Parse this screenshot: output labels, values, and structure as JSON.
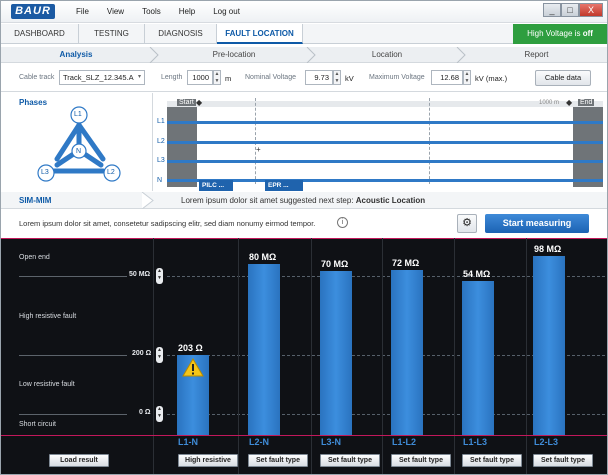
{
  "app": {
    "logo": "BAUR"
  },
  "menu": [
    "File",
    "View",
    "Tools",
    "Help",
    "Log out"
  ],
  "window_controls": {
    "minimize": "_",
    "maximize": "□",
    "close": "X"
  },
  "tabs": [
    "DASHBOARD",
    "TESTING",
    "DIAGNOSIS",
    "FAULT LOCATION"
  ],
  "active_tab": "FAULT LOCATION",
  "high_voltage": {
    "prefix": "High Voltage is",
    "state": "off",
    "color": "#2e9e3f"
  },
  "steps": [
    "Analysis",
    "Pre-location",
    "Location",
    "Report"
  ],
  "params": {
    "cable_track_label": "Cable track",
    "cable_track_value": "Track_SLZ_12.345.A",
    "length_label": "Length",
    "length_value": "1000",
    "length_unit": "m",
    "nominal_voltage_label": "Nominal Voltage",
    "nominal_voltage_value": "9.73",
    "nominal_voltage_unit": "kV",
    "max_voltage_label": "Maximum Voltage",
    "max_voltage_value": "12.68",
    "max_voltage_unit": "kV (max.)",
    "cable_data_button": "Cable data"
  },
  "phases": {
    "title": "Phases",
    "nodes": [
      "L1",
      "L2",
      "L3",
      "N"
    ]
  },
  "cable": {
    "start_label": "Start",
    "end_label": "End",
    "distance_label": "1000 m",
    "lines": [
      "L1",
      "L2",
      "L3",
      "N"
    ],
    "segments": [
      "PILC ...",
      "EPR ..."
    ]
  },
  "sim": {
    "method": "SIM-MIM",
    "suggestion_prefix": "Lorem ipsum dolor sit amet suggested next step:",
    "suggestion_step": "Acoustic Location",
    "description": "Lorem ipsum dolor sit amet, consetetur sadipscing elitr, sed diam nonumy eirmod tempor.",
    "info_icon": "i",
    "start_button": "Start measuring"
  },
  "chart_data": {
    "type": "bar",
    "categories": [
      "L1-N",
      "L2-N",
      "L3-N",
      "L1-L2",
      "L1-L3",
      "L2-L3"
    ],
    "value_labels": [
      "203 Ω",
      "80 MΩ",
      "70 MΩ",
      "72 MΩ",
      "54 MΩ",
      "98 MΩ"
    ],
    "zones": [
      "Open end",
      "High resistive fault",
      "Low resistive fault",
      "Short circuit"
    ],
    "thresholds": [
      "50 MΩ",
      "200 Ω",
      "0 Ω"
    ],
    "warning_category": "L1-N",
    "bar_color": "#3c8ede"
  },
  "actions": {
    "load_result": "Load result",
    "results": [
      "High resistive",
      "Set fault type",
      "Set fault type",
      "Set fault type",
      "Set fault type",
      "Set fault type"
    ]
  }
}
